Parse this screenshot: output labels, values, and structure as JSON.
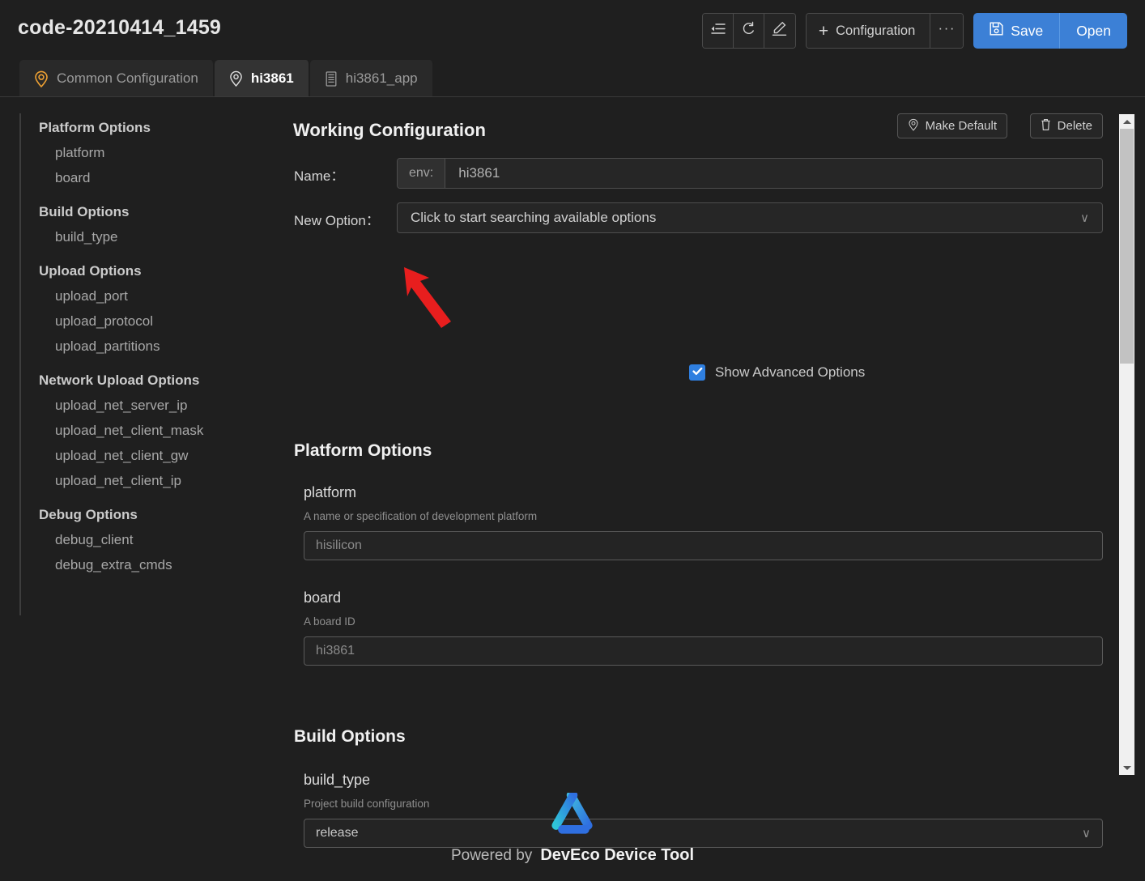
{
  "header": {
    "title": "code-20210414_1459",
    "toolbar": {
      "icons": [
        {
          "name": "collapse-list-icon"
        },
        {
          "name": "refresh-icon"
        },
        {
          "name": "edit-pencil-icon"
        }
      ],
      "configuration_label": "Configuration",
      "plus_glyph": "+",
      "more_glyph": "···",
      "save_label": "Save",
      "open_label": "Open",
      "accent_blue": "#3c80d6"
    }
  },
  "tabs": [
    {
      "label": "Common Configuration",
      "icon": "map-pin-icon",
      "icon_color": "#eda033",
      "active": false
    },
    {
      "label": "hi3861",
      "icon": "map-pin-icon",
      "icon_color": "#e0e0e0",
      "active": true
    },
    {
      "label": "hi3861_app",
      "icon": "server-board-icon",
      "icon_color": "#9b9b9b",
      "active": false
    }
  ],
  "sidebar": {
    "groups": [
      {
        "label": "Platform Options",
        "items": [
          "platform",
          "board"
        ]
      },
      {
        "label": "Build Options",
        "items": [
          "build_type"
        ]
      },
      {
        "label": "Upload Options",
        "items": [
          "upload_port",
          "upload_protocol",
          "upload_partitions"
        ]
      },
      {
        "label": "Network Upload Options",
        "items": [
          "upload_net_server_ip",
          "upload_net_client_mask",
          "upload_net_client_gw",
          "upload_net_client_ip"
        ]
      },
      {
        "label": "Debug Options",
        "items": [
          "debug_client",
          "debug_extra_cmds"
        ]
      }
    ]
  },
  "main": {
    "working_configuration_title": "Working Configuration",
    "make_default_label": "Make Default",
    "delete_label": "Delete",
    "name_label": "Name：",
    "name_prefix": "env:",
    "name_value": "hi3861",
    "new_option_label": "New Option：",
    "new_option_placeholder": "Click to start searching available options",
    "show_advanced_label": "Show Advanced Options",
    "show_advanced_checked": true,
    "sections": [
      {
        "title": "Platform Options",
        "options": [
          {
            "name": "platform",
            "description": "A name or specification of development platform",
            "value": "hisilicon",
            "type": "text"
          },
          {
            "name": "board",
            "description": "A board ID",
            "value": "hi3861",
            "type": "text"
          }
        ]
      },
      {
        "title": "Build Options",
        "options": [
          {
            "name": "build_type",
            "description": "Project build configuration",
            "value": "release",
            "type": "select"
          }
        ]
      }
    ]
  },
  "scrollbar": {
    "up_arrow": "scroll-up-arrow-icon",
    "down_arrow": "scroll-down-arrow-icon",
    "thumb_position_percent": 0
  },
  "footer": {
    "powered_by": "Powered by",
    "brand": "DevEco Device Tool",
    "logo_gradient_from": "#2fc4d8",
    "logo_gradient_to": "#2f6fe0"
  },
  "annotation": {
    "arrow_color": "#e81e1e",
    "points_at": "show-advanced-options-checkbox"
  }
}
